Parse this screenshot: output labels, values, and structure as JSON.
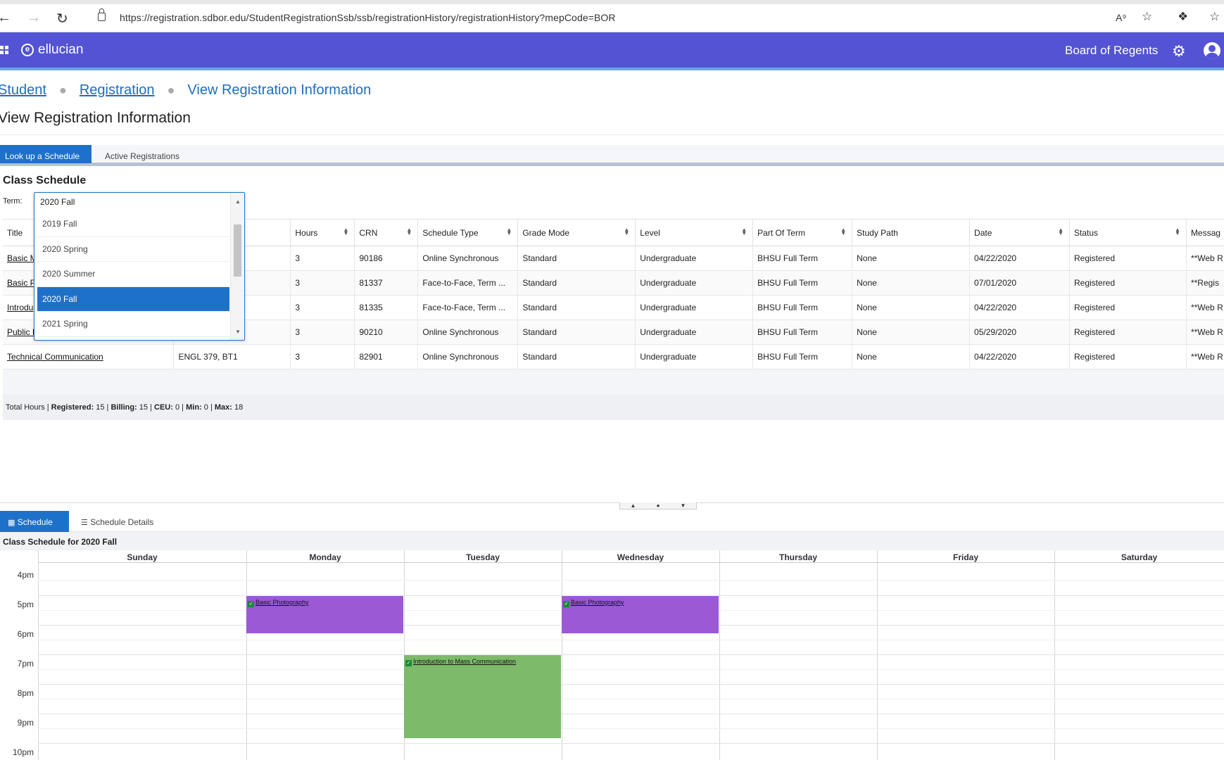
{
  "browser": {
    "url": "https://registration.sdbor.edu/StudentRegistrationSsb/ssb/registrationHistory/registrationHistory?mepCode=BOR"
  },
  "header": {
    "logo_text": "ellucian",
    "institution": "Board of Regents",
    "colors": {
      "header_bg": "#5353d3",
      "accent_line": "#6aa4ea"
    }
  },
  "breadcrumb": {
    "items": [
      "Student",
      "Registration"
    ],
    "current": "View Registration Information"
  },
  "page": {
    "title": "View Registration Information"
  },
  "tabs_top": {
    "lookup": "Look up a Schedule",
    "active": "Active Registrations"
  },
  "section": {
    "title": "Class Schedule",
    "term_label": "Term:"
  },
  "term_select": {
    "current": "2020 Fall",
    "options": [
      "2019 Fall",
      "2020 Spring",
      "2020 Summer",
      "2020 Fall",
      "2021 Spring"
    ],
    "selected": "2020 Fall"
  },
  "table": {
    "columns": [
      "Title",
      "",
      "Hours",
      "CRN",
      "Schedule Type",
      "Grade Mode",
      "Level",
      "Part Of Term",
      "Study Path",
      "Date",
      "Status",
      "Messag"
    ],
    "rows": [
      [
        "Basic M",
        "",
        "3",
        "90186",
        "Online Synchronous",
        "Standard",
        "Undergraduate",
        "BHSU Full Term",
        "None",
        "04/22/2020",
        "Registered",
        "**Web R"
      ],
      [
        "Basic P",
        "",
        "3",
        "81337",
        "Face-to-Face, Term ...",
        "Standard",
        "Undergraduate",
        "BHSU Full Term",
        "None",
        "07/01/2020",
        "Registered",
        "**Regis"
      ],
      [
        "Introdu",
        "",
        "3",
        "81335",
        "Face-to-Face, Term ...",
        "Standard",
        "Undergraduate",
        "BHSU Full Term",
        "None",
        "04/22/2020",
        "Registered",
        "**Web R"
      ],
      [
        "Public R",
        "",
        "3",
        "90210",
        "Online Synchronous",
        "Standard",
        "Undergraduate",
        "BHSU Full Term",
        "None",
        "05/29/2020",
        "Registered",
        "**Web R"
      ],
      [
        "Technical Communication",
        "ENGL 379, BT1",
        "3",
        "82901",
        "Online Synchronous",
        "Standard",
        "Undergraduate",
        "BHSU Full Term",
        "None",
        "04/22/2020",
        "Registered",
        "**Web R"
      ]
    ]
  },
  "totals": {
    "prefix": "Total Hours |",
    "registered_label": "Registered:",
    "registered": "15",
    "billing_label": "Billing:",
    "billing": "15",
    "ceu_label": "CEU:",
    "ceu": "0",
    "min_label": "Min:",
    "min": "0",
    "max_label": "Max:",
    "max": "18"
  },
  "tabs_bottom": {
    "schedule": "Schedule",
    "details": "Schedule Details"
  },
  "schedule": {
    "heading": "Class Schedule for 2020 Fall",
    "days": [
      "Sunday",
      "Monday",
      "Tuesday",
      "Wednesday",
      "Thursday",
      "Friday",
      "Saturday"
    ],
    "hours": [
      "4pm",
      "5pm",
      "6pm",
      "7pm",
      "8pm",
      "9pm",
      "10pm"
    ],
    "events": [
      {
        "title": "Basic Photography",
        "day": "Monday",
        "start": "5pm",
        "end": "6:15pm",
        "color": "#9b59d6"
      },
      {
        "title": "Basic Photography",
        "day": "Wednesday",
        "start": "5pm",
        "end": "6:15pm",
        "color": "#9b59d6"
      },
      {
        "title": "Introduction to Mass Communication",
        "day": "Tuesday",
        "start": "7pm",
        "end": "9:50pm",
        "color": "#7dba6a"
      }
    ]
  }
}
